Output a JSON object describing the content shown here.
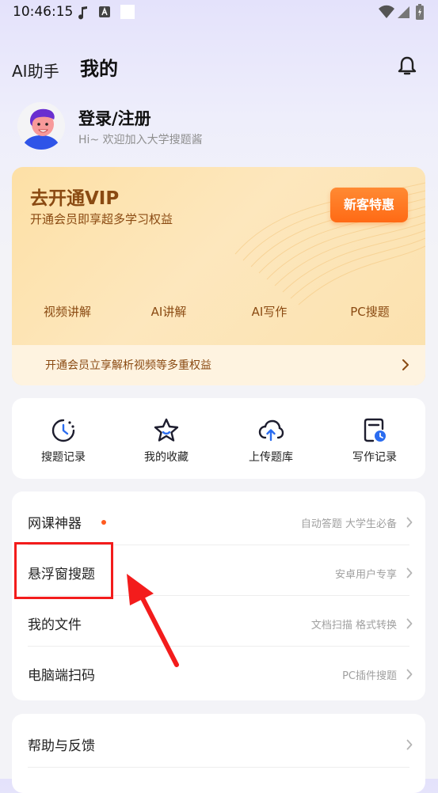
{
  "status_bar": {
    "time": "10:46:15",
    "icons": [
      "music-note-icon",
      "a-badge-icon",
      "white-square-icon",
      "wifi-icon",
      "signal-icon",
      "battery-icon"
    ]
  },
  "header": {
    "app_name": "AI助手",
    "page_title": "我的",
    "bell_icon": "bell-icon"
  },
  "profile": {
    "title": "登录/注册",
    "subtitle": "Hi~ 欢迎加入大学搜题酱"
  },
  "vip": {
    "title": "去开通VIP",
    "description": "开通会员即享超多学习权益",
    "cta": "新客特惠",
    "benefits": [
      "视频讲解",
      "AI讲解",
      "AI写作",
      "PC搜题"
    ],
    "bottom_text": "开通会员立享解析视频等多重权益"
  },
  "shortcuts": [
    {
      "label": "搜题记录",
      "icon": "history-clock-icon"
    },
    {
      "label": "我的收藏",
      "icon": "star-icon"
    },
    {
      "label": "上传题库",
      "icon": "cloud-upload-icon"
    },
    {
      "label": "写作记录",
      "icon": "document-clock-icon"
    }
  ],
  "menu": [
    {
      "label": "网课神器",
      "hint": "自动答题 大学生必备"
    },
    {
      "label": "悬浮窗搜题",
      "hint": "安卓用户专享"
    },
    {
      "label": "我的文件",
      "hint": "文档扫描 格式转换"
    },
    {
      "label": "电脑端扫码",
      "hint": "PC插件搜题"
    }
  ],
  "menu2": [
    {
      "label": "帮助与反馈"
    }
  ],
  "colors": {
    "accent_orange": "#ff6a15",
    "vip_text": "#8a4a12",
    "annotation_red": "#f31c1c"
  }
}
